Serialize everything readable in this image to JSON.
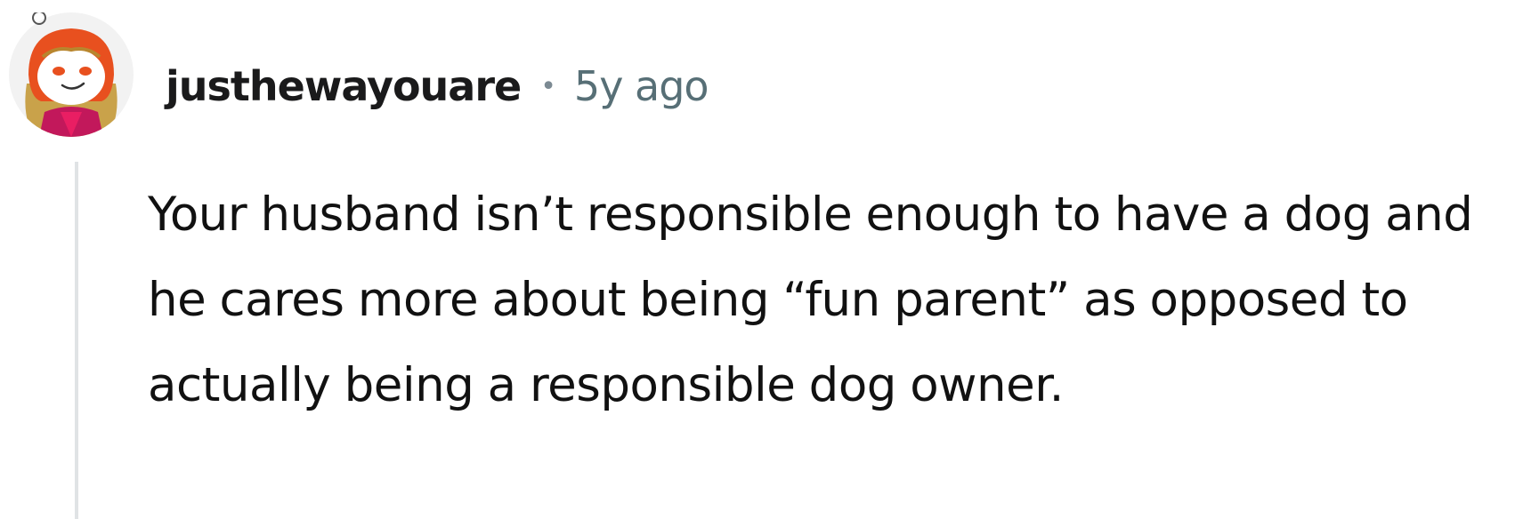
{
  "comment": {
    "avatar_icon": "snoo-avatar-icon",
    "username": "justhewayouare",
    "separator": "•",
    "timestamp": "5y ago",
    "body": "Your husband isn’t responsible enough to have a dog and he cares more about being “fun parent” as opposed to actually being a responsible dog owner."
  },
  "colors": {
    "username": "#1a1a1b",
    "timestamp": "#576f76",
    "thread_line": "#e0e3e5",
    "avatar_hood": "#e8501f"
  }
}
